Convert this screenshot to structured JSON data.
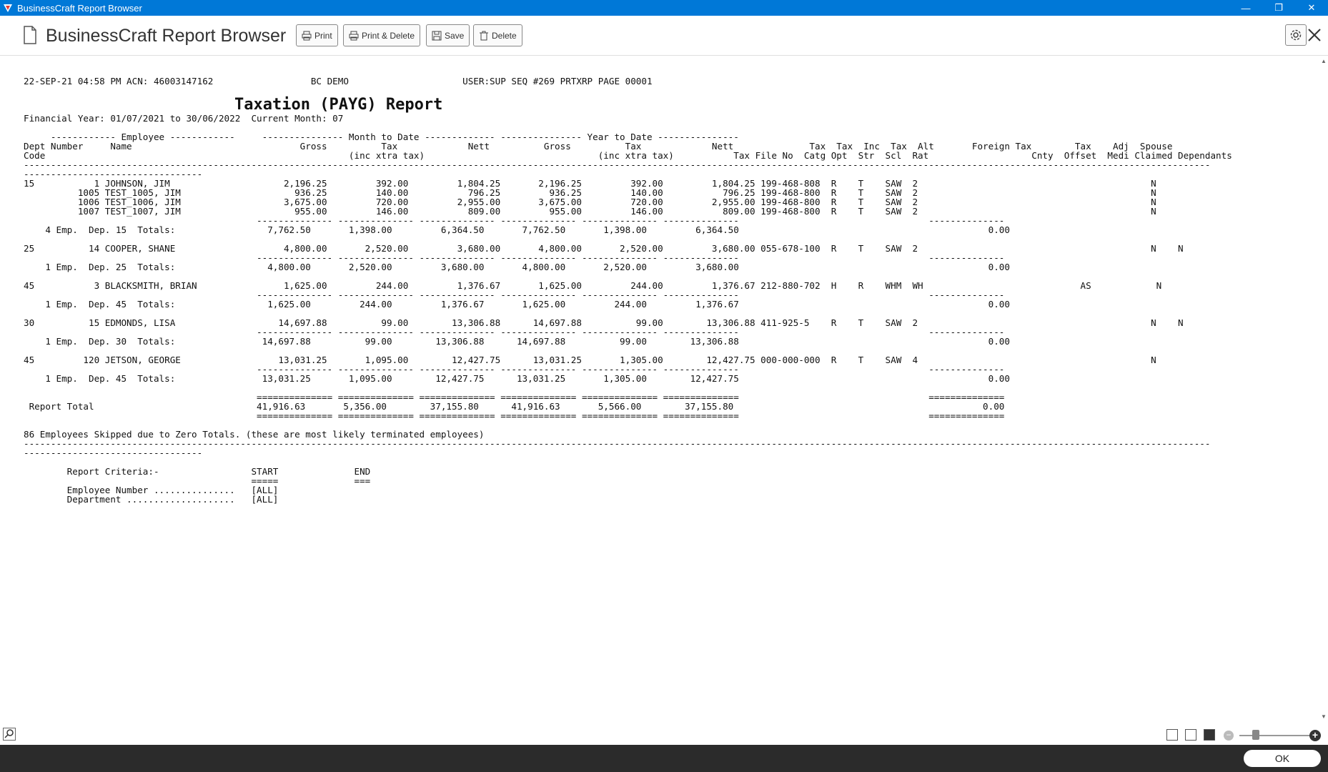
{
  "window": {
    "title": "BusinessCraft Report Browser",
    "minimize_glyph": "—",
    "maximize_glyph": "❐",
    "close_glyph": "✕"
  },
  "header": {
    "title": "BusinessCraft Report Browser",
    "buttons": {
      "print": "Print",
      "print_delete": "Print & Delete",
      "save": "Save",
      "delete": "Delete"
    }
  },
  "report": {
    "title": "Taxation (PAYG) Report",
    "lines": [
      "22-SEP-21 04:58 PM ACN: 46003147162                  BC DEMO                     USER:SUP SEQ #269 PRTXRP PAGE 00001",
      "",
      "",
      "",
      "Financial Year: 01/07/2021 to 30/06/2022  Current Month: 07",
      "",
      "     ------------ Employee ------------     --------------- Month to Date ------------- --------------- Year to Date ---------------",
      "Dept Number     Name                               Gross          Tax             Nett          Gross          Tax             Nett              Tax  Tax  Inc  Tax  Alt       Foreign Tax        Tax    Adj  Spouse",
      "Code                                                        (inc xtra tax)                                (inc xtra tax)           Tax File No  Catg Opt  Str  Scl  Rat                   Cnty  Offset  Medi Claimed Dependants",
      "---------------------------------------------------------------------------------------------------------------------------------------------------------------------------------------------------------------------------",
      "---------------------------------",
      "15           1 JOHNSON, JIM                     2,196.25         392.00         1,804.25       2,196.25         392.00         1,804.25 199-468-808  R    T    SAW  2                                           N",
      "          1005 TEST_1005, JIM                     936.25         140.00           796.25         936.25         140.00           796.25 199-468-800  R    T    SAW  2                                           N",
      "          1006 TEST_1006, JIM                   3,675.00         720.00         2,955.00       3,675.00         720.00         2,955.00 199-468-800  R    T    SAW  2                                           N",
      "          1007 TEST_1007, JIM                     955.00         146.00           809.00         955.00         146.00           809.00 199-468-800  R    T    SAW  2                                           N",
      "                                           -------------- -------------- -------------- -------------- -------------- --------------                                   --------------",
      "    4 Emp.  Dep. 15  Totals:                 7,762.50       1,398.00         6,364.50       7,762.50       1,398.00         6,364.50                                              0.00",
      "",
      "25          14 COOPER, SHANE                    4,800.00       2,520.00         3,680.00       4,800.00       2,520.00         3,680.00 055-678-100  R    T    SAW  2                                           N    N",
      "                                           -------------- -------------- -------------- -------------- -------------- --------------                                   --------------",
      "    1 Emp.  Dep. 25  Totals:                 4,800.00       2,520.00         3,680.00       4,800.00       2,520.00         3,680.00                                              0.00",
      "",
      "45           3 BLACKSMITH, BRIAN                1,625.00         244.00         1,376.67       1,625.00         244.00         1,376.67 212-880-702  H    R    WHM  WH                             AS            N",
      "                                           -------------- -------------- -------------- -------------- -------------- --------------                                   --------------",
      "    1 Emp.  Dep. 45  Totals:                 1,625.00         244.00         1,376.67       1,625.00         244.00         1,376.67                                              0.00",
      "",
      "30          15 EDMONDS, LISA                   14,697.88          99.00        13,306.88      14,697.88          99.00        13,306.88 411-925-5    R    T    SAW  2                                           N    N",
      "                                           -------------- -------------- -------------- -------------- -------------- --------------                                   --------------",
      "    1 Emp.  Dep. 30  Totals:                14,697.88          99.00        13,306.88      14,697.88          99.00        13,306.88                                              0.00",
      "",
      "45         120 JETSON, GEORGE                  13,031.25       1,095.00        12,427.75      13,031.25       1,305.00        12,427.75 000-000-000  R    T    SAW  4                                           N",
      "                                           -------------- -------------- -------------- -------------- -------------- --------------                                   --------------",
      "    1 Emp.  Dep. 45  Totals:                13,031.25       1,095.00        12,427.75      13,031.25       1,305.00        12,427.75                                              0.00",
      "",
      "                                           ============== ============== ============== ============== ============== ==============                                   ==============",
      " Report Total                              41,916.63       5,356.00        37,155.80      41,916.63       5,566.00        37,155.80                                              0.00",
      "                                           ============== ============== ============== ============== ============== ==============                                   ==============",
      "",
      "86 Employees Skipped due to Zero Totals. (these are most likely terminated employees)",
      "---------------------------------------------------------------------------------------------------------------------------------------------------------------------------------------------------------------------------",
      "---------------------------------",
      "",
      "        Report Criteria:-                 START              END",
      "                                          =====              ===",
      "        Employee Number ...............   [ALL]",
      "        Department ....................   [ALL]"
    ]
  },
  "footer": {
    "ok": "OK"
  }
}
